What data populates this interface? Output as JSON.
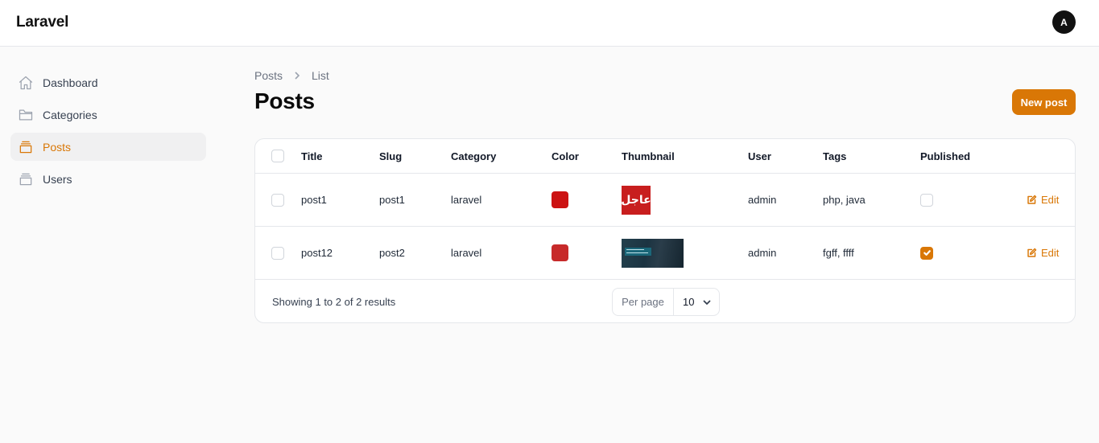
{
  "app": {
    "brand": "Laravel",
    "avatar_initial": "A"
  },
  "sidebar": {
    "items": [
      {
        "label": "Dashboard",
        "icon": "home-icon",
        "active": false
      },
      {
        "label": "Categories",
        "icon": "folder-icon",
        "active": false
      },
      {
        "label": "Posts",
        "icon": "collection-icon",
        "active": true
      },
      {
        "label": "Users",
        "icon": "collection-icon",
        "active": false
      }
    ]
  },
  "breadcrumb": {
    "parent": "Posts",
    "current": "List"
  },
  "header": {
    "title": "Posts",
    "new_button": "New post"
  },
  "accent_color": "#d97706",
  "table": {
    "columns": [
      "Title",
      "Slug",
      "Category",
      "Color",
      "Thumbnail",
      "User",
      "Tags",
      "Published"
    ],
    "rows": [
      {
        "title": "post1",
        "slug": "post1",
        "category": "laravel",
        "color": "#cc1212",
        "thumbnail_text": "عاجل",
        "user": "admin",
        "tags": "php, java",
        "published": false,
        "action": "Edit"
      },
      {
        "title": "post12",
        "slug": "post2",
        "category": "laravel",
        "color": "#c72a2a",
        "thumbnail_text": "",
        "user": "admin",
        "tags": "fgff, ffff",
        "published": true,
        "action": "Edit"
      }
    ]
  },
  "pagination": {
    "summary": "Showing 1 to 2 of 2 results",
    "per_page_label": "Per page",
    "per_page_value": "10"
  }
}
